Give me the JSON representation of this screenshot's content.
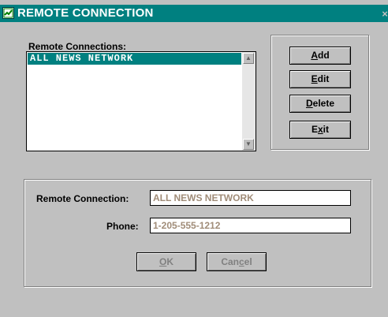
{
  "window": {
    "title": "REMOTE CONNECTION",
    "close_glyph": "×"
  },
  "list": {
    "label": "Remote Connections:",
    "items": [
      "ALL NEWS NETWORK"
    ],
    "selected_index": 0
  },
  "actions": {
    "add": {
      "before": "",
      "mnemonic": "A",
      "after": "dd"
    },
    "edit": {
      "before": "",
      "mnemonic": "E",
      "after": "dit"
    },
    "delete": {
      "before": "",
      "mnemonic": "D",
      "after": "elete"
    },
    "exit": {
      "before": "E",
      "mnemonic": "x",
      "after": "it"
    }
  },
  "details": {
    "remote_connection_label": "Remote Connection:",
    "remote_connection_value": "ALL NEWS NETWORK",
    "phone_label": "Phone:",
    "phone_value": "1-205-555-1212"
  },
  "dialog_buttons": {
    "ok": {
      "before": "",
      "mnemonic": "O",
      "after": "K"
    },
    "cancel": {
      "before": "Can",
      "mnemonic": "c",
      "after": "el"
    }
  },
  "colors": {
    "titlebar": "#008080",
    "selection": "#008080",
    "face": "#c0c0c0",
    "field_text": "#a08c78"
  },
  "icons": {
    "title": "app-window-icon",
    "scroll_up": "scroll-up-arrow-icon",
    "scroll_down": "scroll-down-arrow-icon",
    "close": "close-icon"
  }
}
